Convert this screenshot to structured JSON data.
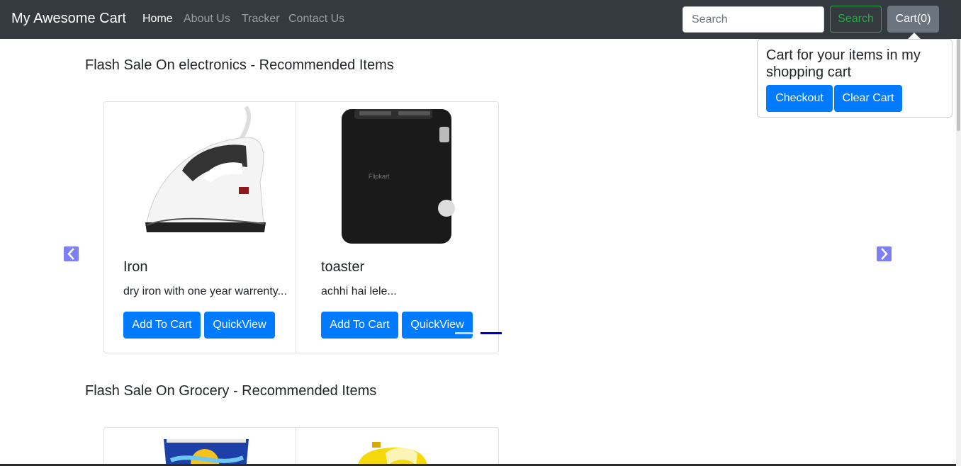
{
  "navbar": {
    "brand": "My Awesome Cart",
    "links": [
      {
        "label": "Home",
        "active": true
      },
      {
        "label": "About Us",
        "active": false
      },
      {
        "label": "Tracker",
        "active": false
      },
      {
        "label": "Contact Us",
        "active": false
      }
    ],
    "search_placeholder": "Search",
    "search_button": "Search",
    "cart_button": "Cart(0)"
  },
  "popover": {
    "title": "Cart for your items in my shopping cart",
    "checkout_label": "Checkout",
    "clear_label": "Clear Cart"
  },
  "sections": [
    {
      "title": "Flash Sale On electronics - Recommended Items",
      "products": [
        {
          "name": "Iron",
          "description": "dry iron with one year warrenty...",
          "add_label": "Add To Cart",
          "view_label": "QuickView",
          "image": "iron-image"
        },
        {
          "name": "toaster",
          "description": "achhi hai lele...",
          "add_label": "Add To Cart",
          "view_label": "QuickView",
          "image": "toaster-image"
        }
      ]
    },
    {
      "title": "Flash Sale On Grocery - Recommended Items",
      "products": [
        {
          "image": "yogurt-tub-image"
        },
        {
          "image": "oil-can-image"
        }
      ]
    }
  ],
  "colors": {
    "navbar_bg": "#343a40",
    "primary": "#007bff",
    "success": "#28a745",
    "secondary": "#6c757d",
    "carousel_control": "#7f7ff5",
    "indicator_active": "#0000cc"
  },
  "icons": {
    "carousel_prev": "chevron-left-icon",
    "carousel_next": "chevron-right-icon"
  }
}
